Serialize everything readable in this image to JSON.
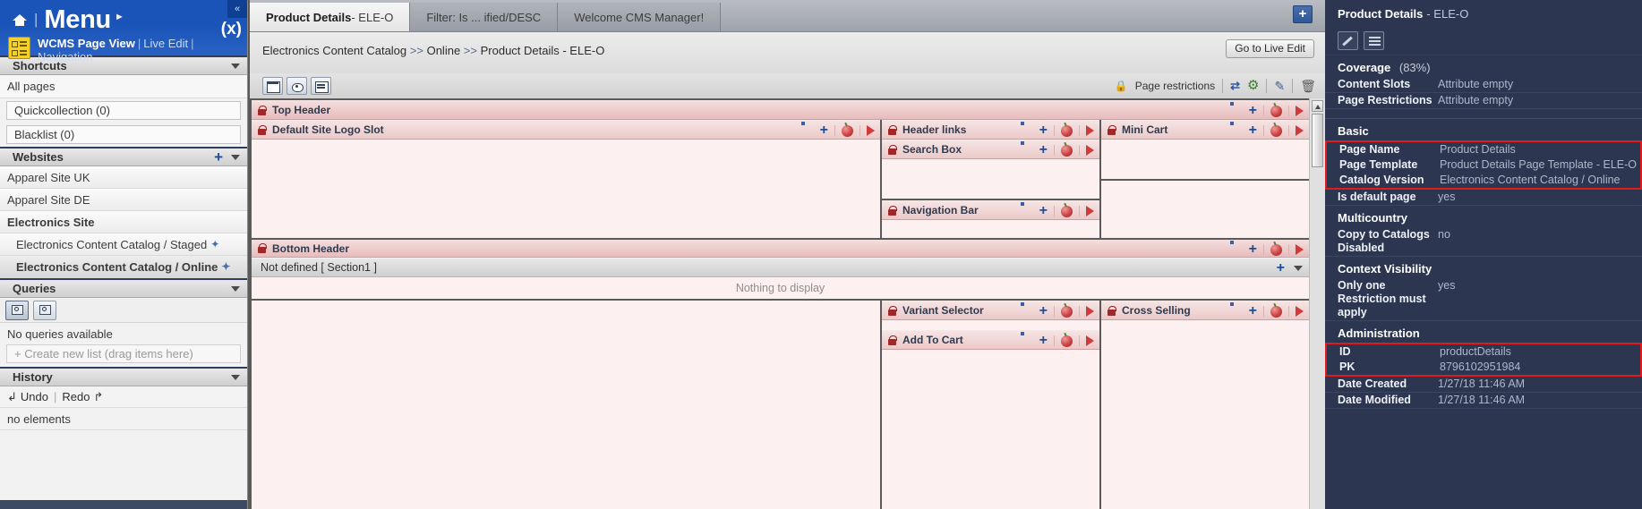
{
  "sidebar": {
    "menu_label": "Menu",
    "home_icon": "home-icon",
    "collapse_icon": "«",
    "x_icon": "(x)",
    "wcms_label": "WCMS Page View",
    "live_edit_label": "Live Edit",
    "navigation_label": "Navigation",
    "shortcuts": {
      "title": "Shortcuts",
      "all_pages": "All pages",
      "quickcollection": "Quickcollection (0)",
      "blacklist": "Blacklist (0)"
    },
    "websites": {
      "title": "Websites",
      "items": [
        {
          "label": "Apparel Site UK",
          "bold": false,
          "indent": false,
          "selected": false,
          "catalog": false
        },
        {
          "label": "Apparel Site DE",
          "bold": false,
          "indent": false,
          "selected": false,
          "catalog": false
        },
        {
          "label": "Electronics Site",
          "bold": true,
          "indent": false,
          "selected": false,
          "catalog": false
        },
        {
          "label": "Electronics Content Catalog / Staged",
          "bold": false,
          "indent": true,
          "selected": false,
          "catalog": true
        },
        {
          "label": "Electronics Content Catalog / Online",
          "bold": true,
          "indent": true,
          "selected": true,
          "catalog": true
        }
      ]
    },
    "queries": {
      "title": "Queries",
      "no_queries": "No queries available",
      "create_new_list": "+ Create new list (drag items here)"
    },
    "history": {
      "title": "History",
      "undo": "Undo",
      "redo": "Redo",
      "no_elements": "no elements"
    }
  },
  "main": {
    "tabs": [
      {
        "label_bold": "Product Details",
        "label_dim": " - ELE-O",
        "active": true
      },
      {
        "label_bold": "",
        "label_dim": "Filter: Is ... ified/DESC",
        "active": false
      },
      {
        "label_bold": "",
        "label_dim": "Welcome CMS Manager!",
        "active": false
      }
    ],
    "add_tab_label": "+",
    "breadcrumb": {
      "parts": [
        "Electronics Content Catalog",
        "Online",
        "Product Details - ELE-O"
      ],
      "separator": ">>"
    },
    "live_edit_button": "Go to Live Edit",
    "toolbar_icons": [
      "page-layout-icon",
      "preview-eye-icon",
      "details-list-icon"
    ],
    "page_restrictions_label": "Page restrictions",
    "restriction_icons": [
      "lock-icon",
      "sync-arrows-icon",
      "gear-icon",
      "pencil-icon",
      "trash-icon"
    ],
    "slots": {
      "top_header": "Top Header",
      "default_site_logo": "Default Site Logo Slot",
      "header_links": "Header links",
      "search_box": "Search Box",
      "mini_cart": "Mini Cart",
      "navigation_bar": "Navigation Bar",
      "bottom_header": "Bottom Header",
      "variant_selector": "Variant Selector",
      "add_to_cart": "Add To Cart",
      "cross_selling": "Cross Selling"
    },
    "not_defined_row": "Not defined [ Section1 ]",
    "nothing_to_display": "Nothing to display"
  },
  "right_panel": {
    "title_bold": "Product Details",
    "title_dim": "- ELE-O",
    "tool_icons": [
      "pencil-icon",
      "properties-icon"
    ],
    "sections": [
      {
        "name": "Coverage",
        "pct": "(83%)",
        "highlight": false,
        "rows": [
          {
            "key": "Content Slots",
            "value": "Attribute empty",
            "highlight": false
          },
          {
            "key": "Page Restrictions",
            "value": "Attribute empty",
            "highlight": false
          }
        ]
      },
      {
        "name": "Basic",
        "pct": "",
        "highlight": false,
        "rows": [
          {
            "key": "Page Name",
            "value": "Product Details",
            "highlight": true
          },
          {
            "key": "Page Template",
            "value": "Product Details Page Template - ELE-O",
            "highlight": true
          },
          {
            "key": "Catalog Version",
            "value": "Electronics Content Catalog / Online",
            "highlight": true
          },
          {
            "key": "Is default page",
            "value": "yes",
            "highlight": false
          }
        ]
      },
      {
        "name": "Multicountry",
        "pct": "",
        "highlight": false,
        "rows": [
          {
            "key": "Copy to Catalogs Disabled",
            "value": "no",
            "highlight": false
          }
        ]
      },
      {
        "name": "Context Visibility",
        "pct": "",
        "highlight": false,
        "rows": [
          {
            "key": "Only one Restriction must apply",
            "value": "yes",
            "highlight": false
          }
        ]
      },
      {
        "name": "Administration",
        "pct": "",
        "highlight": false,
        "rows": [
          {
            "key": "ID",
            "value": "productDetails",
            "highlight": true
          },
          {
            "key": "PK",
            "value": "8796102951984",
            "highlight": true
          },
          {
            "key": "Date Created",
            "value": "1/27/18 11:46 AM",
            "highlight": false
          },
          {
            "key": "Date Modified",
            "value": "1/27/18 11:46 AM",
            "highlight": false
          }
        ]
      }
    ]
  },
  "colors": {
    "brand_blue": "#1a54b8",
    "panel_dark": "#2c3650",
    "slot_pink": "#e7bcbc",
    "highlight_red": "#e01b1b"
  }
}
